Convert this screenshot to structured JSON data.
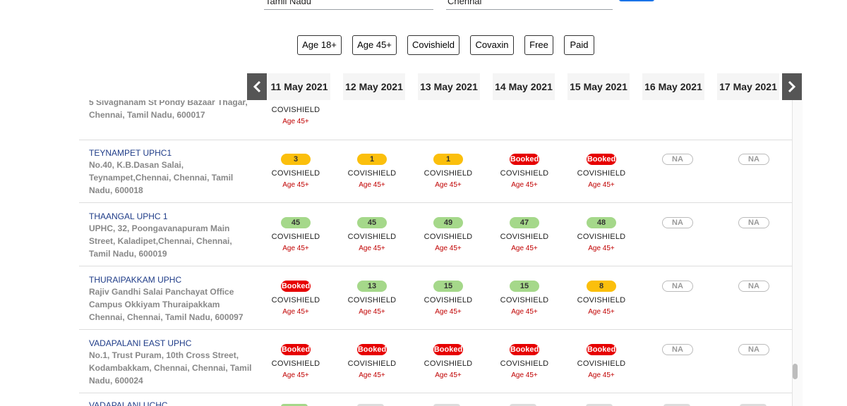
{
  "search": {
    "state_value": "Tamil Nadu",
    "district_value": "Chennai"
  },
  "filters": [
    "Age 18+",
    "Age 45+",
    "Covishield",
    "Covaxin",
    "Free",
    "Paid"
  ],
  "dates": [
    "11 May 2021",
    "12 May 2021",
    "13 May 2021",
    "14 May 2021",
    "15 May 2021",
    "16 May 2021",
    "17 May 2021"
  ],
  "colors": {
    "available_green": "#a5d88a",
    "limited_yellow": "#fbbf0c",
    "booked_red": "#e60000",
    "link_blue": "#1f3c88"
  },
  "top_partial": {
    "address": "5 Sivaghanam St Pondy Bazaar Thagar, Chennai, Tamil Nadu, 600017",
    "vaccine": "COVISHIELD",
    "age": "Age 45+"
  },
  "centers": [
    {
      "name": "TEYNAMPET UPHC1",
      "address": "No.40, K.B.Dasan Salai, Teynampet,Chennai, Chennai, Tamil Nadu, 600018",
      "slots": [
        {
          "status": "yellow",
          "label": "3",
          "vaccine": "COVISHIELD",
          "age": "Age 45+"
        },
        {
          "status": "yellow",
          "label": "1",
          "vaccine": "COVISHIELD",
          "age": "Age 45+"
        },
        {
          "status": "yellow",
          "label": "1",
          "vaccine": "COVISHIELD",
          "age": "Age 45+"
        },
        {
          "status": "red",
          "label": "Booked",
          "vaccine": "COVISHIELD",
          "age": "Age 45+"
        },
        {
          "status": "red",
          "label": "Booked",
          "vaccine": "COVISHIELD",
          "age": "Age 45+"
        },
        {
          "status": "na",
          "label": "NA"
        },
        {
          "status": "na",
          "label": "NA"
        }
      ]
    },
    {
      "name": "THAANGAL UPHC 1",
      "address": "UPHC, 32, Poongavanapuram Main Street, Kaladipet,Chennai, Chennai, Tamil Nadu, 600019",
      "slots": [
        {
          "status": "green",
          "label": "45",
          "vaccine": "COVISHIELD",
          "age": "Age 45+"
        },
        {
          "status": "green",
          "label": "45",
          "vaccine": "COVISHIELD",
          "age": "Age 45+"
        },
        {
          "status": "green",
          "label": "49",
          "vaccine": "COVISHIELD",
          "age": "Age 45+"
        },
        {
          "status": "green",
          "label": "47",
          "vaccine": "COVISHIELD",
          "age": "Age 45+"
        },
        {
          "status": "green",
          "label": "48",
          "vaccine": "COVISHIELD",
          "age": "Age 45+"
        },
        {
          "status": "na",
          "label": "NA"
        },
        {
          "status": "na",
          "label": "NA"
        }
      ]
    },
    {
      "name": "THURAIPAKKAM UPHC",
      "address": "Rajiv Gandhi Salai Panchayat Office Campus Okkiyam Thuraipakkam Chennai, Chennai, Tamil Nadu, 600097",
      "slots": [
        {
          "status": "red",
          "label": "Booked",
          "vaccine": "COVISHIELD",
          "age": "Age 45+"
        },
        {
          "status": "green",
          "label": "13",
          "vaccine": "COVISHIELD",
          "age": "Age 45+"
        },
        {
          "status": "green",
          "label": "15",
          "vaccine": "COVISHIELD",
          "age": "Age 45+"
        },
        {
          "status": "green",
          "label": "15",
          "vaccine": "COVISHIELD",
          "age": "Age 45+"
        },
        {
          "status": "yellow",
          "label": "8",
          "vaccine": "COVISHIELD",
          "age": "Age 45+"
        },
        {
          "status": "na",
          "label": "NA"
        },
        {
          "status": "na",
          "label": "NA"
        }
      ]
    },
    {
      "name": "VADAPALANI EAST UPHC",
      "address": "No.1, Trust Puram, 10th Cross Street, Kodambakkam, Chennai, Chennai, Tamil Nadu, 600024",
      "slots": [
        {
          "status": "red",
          "label": "Booked",
          "vaccine": "COVISHIELD",
          "age": "Age 45+"
        },
        {
          "status": "red",
          "label": "Booked",
          "vaccine": "COVISHIELD",
          "age": "Age 45+"
        },
        {
          "status": "red",
          "label": "Booked",
          "vaccine": "COVISHIELD",
          "age": "Age 45+"
        },
        {
          "status": "red",
          "label": "Booked",
          "vaccine": "COVISHIELD",
          "age": "Age 45+"
        },
        {
          "status": "red",
          "label": "Booked",
          "vaccine": "COVISHIELD",
          "age": "Age 45+"
        },
        {
          "status": "na",
          "label": "NA"
        },
        {
          "status": "na",
          "label": "NA"
        }
      ]
    }
  ],
  "bottom_partial": {
    "name": "VADAPALANI UCHC"
  }
}
